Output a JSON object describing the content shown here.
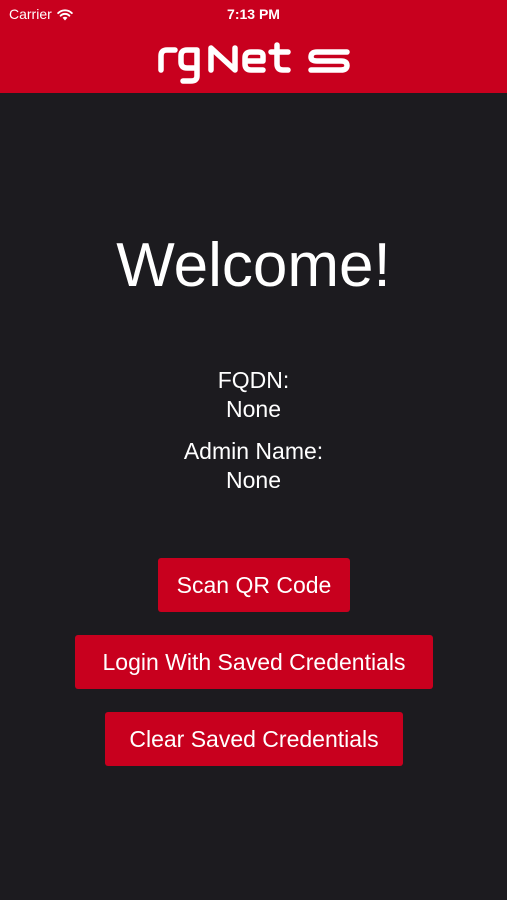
{
  "status_bar": {
    "carrier": "Carrier",
    "time": "7:13 PM"
  },
  "header": {
    "logo_text": "rgNets",
    "background_color": "#c8001e"
  },
  "main": {
    "welcome": "Welcome!",
    "fqdn_label": "FQDN:",
    "fqdn_value": "None",
    "admin_label": "Admin Name:",
    "admin_value": "None"
  },
  "buttons": {
    "scan_qr": "Scan QR Code",
    "login_saved": "Login With Saved Credentials",
    "clear_saved": "Clear Saved Credentials"
  },
  "colors": {
    "accent": "#c8001e",
    "background": "#1c1b1f",
    "text": "#ffffff"
  }
}
